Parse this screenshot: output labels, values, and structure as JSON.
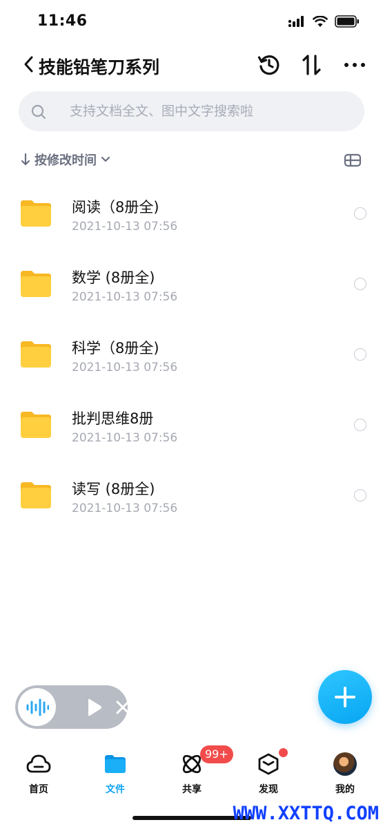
{
  "status_bar": {
    "time": "11:46"
  },
  "header": {
    "title": "技能铅笔刀系列"
  },
  "search": {
    "placeholder": "支持文档全文、图中文字搜索啦"
  },
  "sort": {
    "label": "按修改时间"
  },
  "files": [
    {
      "name": "阅读（8册全)",
      "date": "2021-10-13 07:56"
    },
    {
      "name": "数学 (8册全)",
      "date": "2021-10-13 07:56"
    },
    {
      "name": "科学（8册全)",
      "date": "2021-10-13 07:56"
    },
    {
      "name": "批判思维8册",
      "date": "2021-10-13 07:56"
    },
    {
      "name": "读写 (8册全)",
      "date": "2021-10-13 07:56"
    }
  ],
  "tabbar": {
    "items": [
      {
        "label": "首页",
        "icon": "cloud-icon"
      },
      {
        "label": "文件",
        "icon": "folder-icon"
      },
      {
        "label": "共享",
        "icon": "share-orbit-icon"
      },
      {
        "label": "发现",
        "icon": "cube-icon"
      },
      {
        "label": "我的",
        "icon": "avatar"
      }
    ],
    "active": "文件",
    "share_badge": "99+"
  },
  "colors": {
    "accent": "#10a4f4",
    "folder": "#ffc83d",
    "badge": "#f24b4b",
    "watermark": "#1040ff"
  },
  "watermark": "WWW.XXTTQ.COM"
}
